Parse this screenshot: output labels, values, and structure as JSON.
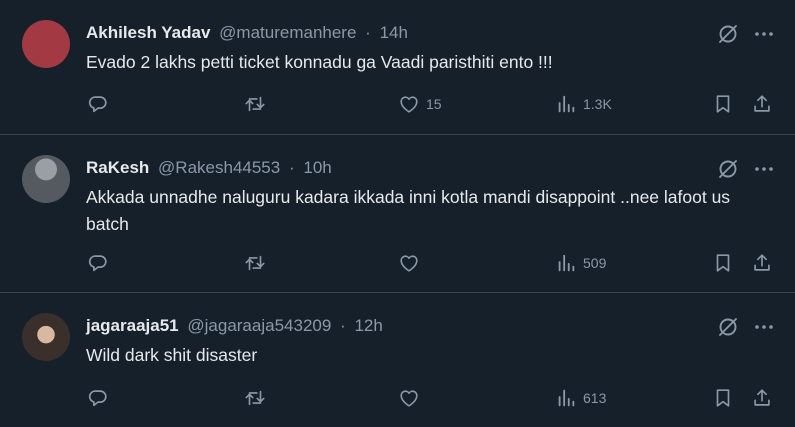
{
  "tweets": [
    {
      "name": "Akhilesh Yadav",
      "handle": "@maturemanhere",
      "dot": "·",
      "time": "14h",
      "text": "Evado 2 lakhs petti ticket konnadu ga Vaadi paristhiti ento !!!",
      "likes": "15",
      "views": "1.3K",
      "avatar_color": "#a33a43"
    },
    {
      "name": "RaKesh",
      "handle": "@Rakesh44553",
      "dot": "·",
      "time": "10h",
      "text": "Akkada unnadhe naluguru kadara ikkada inni kotla mandi disappoint ..nee lafoot us batch",
      "likes": "",
      "views": "509",
      "avatar_color": "#6b7077"
    },
    {
      "name": "jagaraaja51",
      "handle": "@jagaraaja543209",
      "dot": "·",
      "time": "12h",
      "text": "Wild dark shit disaster",
      "likes": "",
      "views": "613",
      "avatar_color": "#2a2a2a"
    }
  ],
  "colors": {
    "background": "#15202b",
    "text": "#e7e9ea",
    "muted": "#8b98a5",
    "divider": "#38444d"
  },
  "icons": [
    "grok-icon",
    "more-icon",
    "reply-icon",
    "retweet-icon",
    "like-icon",
    "views-icon",
    "bookmark-icon",
    "share-icon"
  ]
}
